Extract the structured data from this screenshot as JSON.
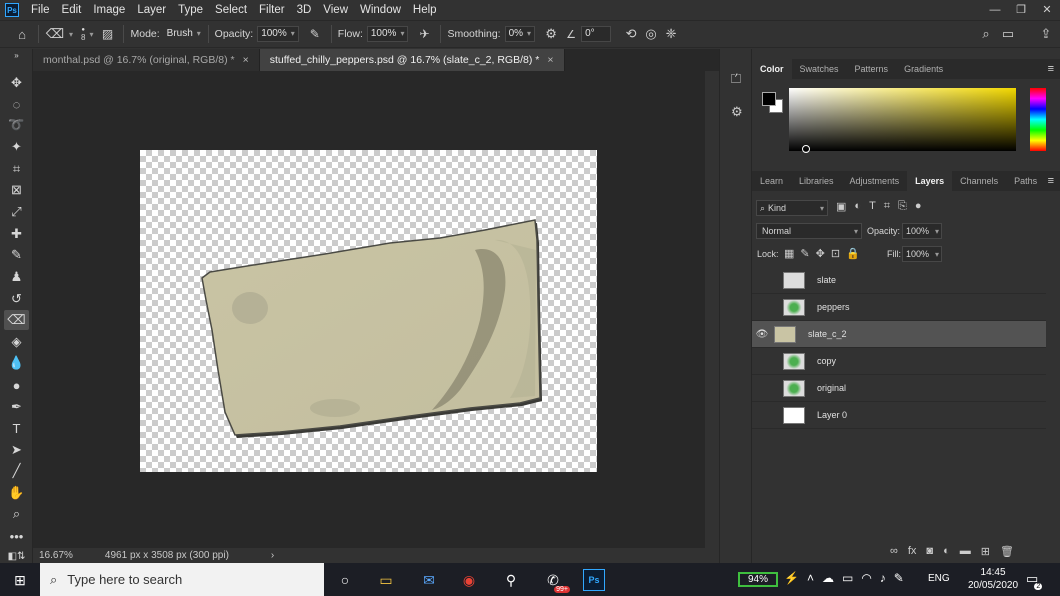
{
  "app": {
    "logo_text": "Ps",
    "menu": [
      "File",
      "Edit",
      "Image",
      "Layer",
      "Type",
      "Select",
      "Filter",
      "3D",
      "View",
      "Window",
      "Help"
    ],
    "window_controls": [
      "—",
      "❐",
      "✕"
    ]
  },
  "options_bar": {
    "brush_size": "8",
    "mode_label": "Mode:",
    "mode_value": "Brush",
    "opacity_label": "Opacity:",
    "opacity_value": "100%",
    "flow_label": "Flow:",
    "flow_value": "100%",
    "smoothing_label": "Smoothing:",
    "smoothing_value": "0%",
    "angle_value": "0°"
  },
  "tabs": [
    {
      "label": "monthal.psd @ 16.7% (original, RGB/8) *",
      "active": false
    },
    {
      "label": "stuffed_chilly_peppers.psd @ 16.7% (slate_c_2, RGB/8) *",
      "active": true
    }
  ],
  "status": {
    "zoom": "16.67%",
    "doc_size": "4961 px x 3508 px (300 ppi)"
  },
  "color_panel": {
    "tabs": [
      "Color",
      "Swatches",
      "Patterns",
      "Gradients"
    ],
    "active_tab": "Color",
    "foreground": "#000000",
    "background": "#ffffff",
    "hue_color": "#f2d800"
  },
  "layers_panel": {
    "tabs": [
      "Learn",
      "Libraries",
      "Adjustments",
      "Layers",
      "Channels",
      "Paths"
    ],
    "active_tab": "Layers",
    "filter_label": "Kind",
    "blend_mode": "Normal",
    "opacity_label": "Opacity:",
    "opacity_value": "100%",
    "lock_label": "Lock:",
    "fill_label": "Fill:",
    "fill_value": "100%",
    "layers": [
      {
        "name": "slate",
        "visible": false,
        "selected": false
      },
      {
        "name": "peppers",
        "visible": false,
        "selected": false
      },
      {
        "name": "slate_c_2",
        "visible": true,
        "selected": true
      },
      {
        "name": "copy",
        "visible": false,
        "selected": false
      },
      {
        "name": "original",
        "visible": false,
        "selected": false
      },
      {
        "name": "Layer 0",
        "visible": false,
        "selected": false
      }
    ]
  },
  "taskbar": {
    "search_placeholder": "Type here to search",
    "battery": "94%",
    "language": "ENG",
    "time": "14:45",
    "date": "20/05/2020",
    "notification_count": "2",
    "mail_badge": "99+"
  }
}
